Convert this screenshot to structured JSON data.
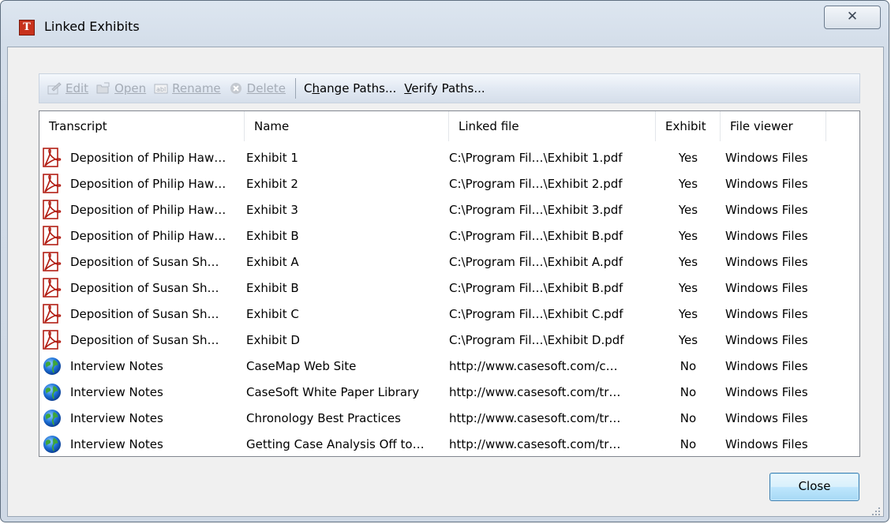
{
  "window": {
    "title": "Linked Exhibits",
    "close_glyph": "✕",
    "app_icon_letter": "T"
  },
  "toolbar": {
    "edit": "Edit",
    "open": "Open",
    "rename": "Rename",
    "delete": "Delete",
    "change_paths": "Change Paths...",
    "verify_paths": "Verify Paths..."
  },
  "columns": [
    "Transcript",
    "Name",
    "Linked file",
    "Exhibit",
    "File viewer"
  ],
  "rows": [
    {
      "icon": "pdf-icon",
      "transcript": "Deposition of Philip Haw…",
      "name": "Exhibit 1",
      "file": "C:\\Program Fil…\\Exhibit 1.pdf",
      "exhibit": "Yes",
      "viewer": "Windows Files"
    },
    {
      "icon": "pdf-icon",
      "transcript": "Deposition of Philip Haw…",
      "name": "Exhibit 2",
      "file": "C:\\Program Fil…\\Exhibit 2.pdf",
      "exhibit": "Yes",
      "viewer": "Windows Files"
    },
    {
      "icon": "pdf-icon",
      "transcript": "Deposition of Philip Haw…",
      "name": "Exhibit 3",
      "file": "C:\\Program Fil…\\Exhibit 3.pdf",
      "exhibit": "Yes",
      "viewer": "Windows Files"
    },
    {
      "icon": "pdf-icon",
      "transcript": "Deposition of Philip Haw…",
      "name": "Exhibit B",
      "file": "C:\\Program Fil…\\Exhibit B.pdf",
      "exhibit": "Yes",
      "viewer": "Windows Files"
    },
    {
      "icon": "pdf-icon",
      "transcript": "Deposition of Susan Sh…",
      "name": "Exhibit A",
      "file": "C:\\Program Fil…\\Exhibit A.pdf",
      "exhibit": "Yes",
      "viewer": "Windows Files"
    },
    {
      "icon": "pdf-icon",
      "transcript": "Deposition of Susan Sh…",
      "name": "Exhibit B",
      "file": "C:\\Program Fil…\\Exhibit B.pdf",
      "exhibit": "Yes",
      "viewer": "Windows Files"
    },
    {
      "icon": "pdf-icon",
      "transcript": "Deposition of Susan Sh…",
      "name": "Exhibit C",
      "file": "C:\\Program Fil…\\Exhibit C.pdf",
      "exhibit": "Yes",
      "viewer": "Windows Files"
    },
    {
      "icon": "pdf-icon",
      "transcript": "Deposition of Susan Sh…",
      "name": "Exhibit D",
      "file": "C:\\Program Fil…\\Exhibit D.pdf",
      "exhibit": "Yes",
      "viewer": "Windows Files"
    },
    {
      "icon": "globe-icon",
      "transcript": "Interview Notes",
      "name": "CaseMap Web Site",
      "file": "http://www.casesoft.com/c…",
      "exhibit": "No",
      "viewer": "Windows Files"
    },
    {
      "icon": "globe-icon",
      "transcript": "Interview Notes",
      "name": "CaseSoft White Paper Library",
      "file": "http://www.casesoft.com/tr…",
      "exhibit": "No",
      "viewer": "Windows Files"
    },
    {
      "icon": "globe-icon",
      "transcript": "Interview Notes",
      "name": "Chronology Best Practices",
      "file": "http://www.casesoft.com/tr…",
      "exhibit": "No",
      "viewer": "Windows Files"
    },
    {
      "icon": "globe-icon",
      "transcript": "Interview Notes",
      "name": "Getting Case Analysis Off to…",
      "file": "http://www.casesoft.com/tr…",
      "exhibit": "No",
      "viewer": "Windows Files"
    }
  ],
  "buttons": {
    "close": "Close"
  }
}
